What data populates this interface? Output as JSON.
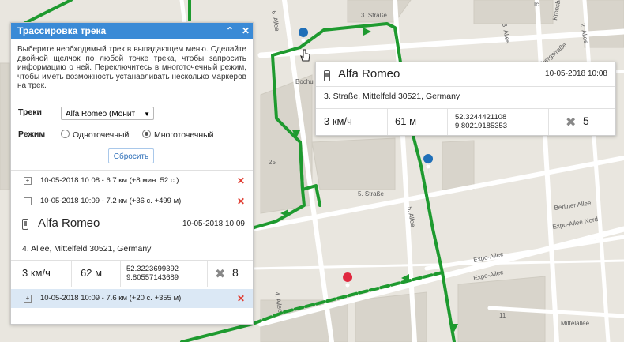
{
  "map": {
    "street_labels": [
      "3. Straße",
      "5. Straße",
      "6. Allee",
      "5. Allee",
      "4. Allee",
      "3. Allee",
      "2. Allee",
      "Berliner Allee",
      "Expo-Allee Nord",
      "Expo-Allee",
      "Expo-Allee",
      "Mittelallee",
      "Bochu",
      "25",
      "11",
      "Kronsbergstraße",
      "Kronsbergstraße",
      "Ic"
    ],
    "colors": {
      "track": "#1e9a2f",
      "land": "#e9e6df",
      "block": "#d7d3ca",
      "road": "#ffffff",
      "marker_blue": "#1f6fb8",
      "marker_red": "#e0283f"
    }
  },
  "panel": {
    "title": "Трассировка трека",
    "collapse_icon": "double-chevron-up-icon",
    "close_icon": "close-icon",
    "description": "Выберите необходимый трек в выпадающем меню. Сделайте двойной щелчок по любой точке трека, чтобы запросить информацию о ней. Переключитесь в многоточечный режим, чтобы иметь возможность устанавливать несколько маркеров на трек.",
    "tracks_label": "Треки",
    "tracks_select": "Alfa Romeo (Монит",
    "mode_label": "Режим",
    "mode_single": "Одноточечный",
    "mode_multi": "Многоточечный",
    "mode_selected": "multi",
    "reset_button": "Сбросить",
    "tracks": [
      {
        "toggle": "+",
        "text": "10-05-2018 10:08 - 6.7 км (+8 мин. 52 с.)",
        "selected": false
      },
      {
        "toggle": "−",
        "text": "10-05-2018 10:09 - 7.2 км (+36 с. +499 м)",
        "selected": false
      },
      {
        "toggle": "+",
        "text": "10-05-2018 10:09 - 7.6 км (+20 с. +355 м)",
        "selected": true
      }
    ],
    "info": {
      "unit": "Alfa Romeo",
      "time": "10-05-2018 10:09",
      "address": "4. Allee, Mittelfeld 30521, Germany",
      "speed": "3 км/ч",
      "distance": "62 м",
      "lat": "52.3223699392",
      "lon": "9.80557143689",
      "satellites": "8"
    }
  },
  "popup": {
    "unit": "Alfa Romeo",
    "time": "10-05-2018 10:08",
    "address": "3. Straße, Mittelfeld 30521, Germany",
    "speed": "3 км/ч",
    "distance": "61 м",
    "lat": "52.3244421108",
    "lon": "9.80219185353",
    "satellites": "5"
  }
}
